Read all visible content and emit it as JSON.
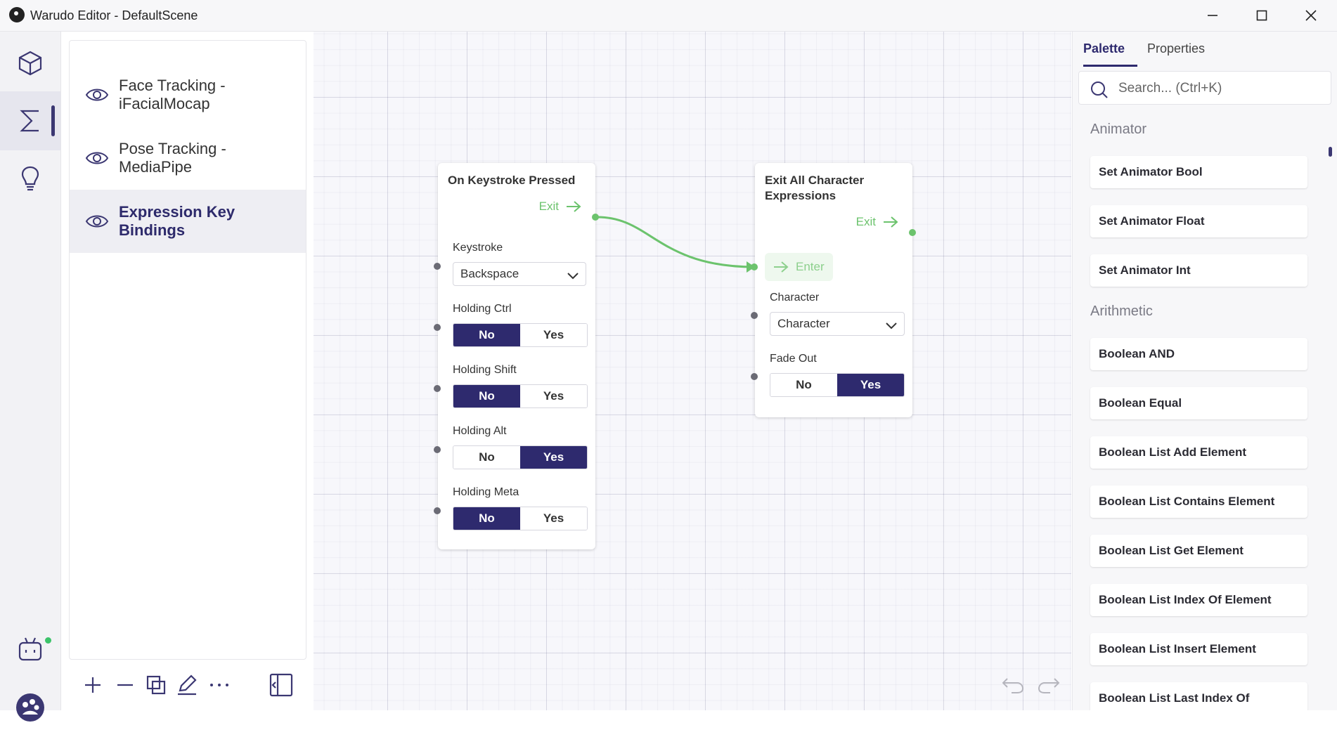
{
  "window": {
    "title": "Warudo Editor - DefaultScene"
  },
  "rail": {
    "items": [
      {
        "icon": "cube-icon"
      },
      {
        "icon": "sigma-icon",
        "active": true
      },
      {
        "icon": "lightbulb-icon"
      }
    ],
    "bottom_items": [
      {
        "icon": "bot-icon",
        "status": "online"
      },
      {
        "icon": "warudo-logo-icon"
      }
    ]
  },
  "graphs": {
    "items": [
      {
        "label": "Face Tracking - iFacialMocap",
        "line1": "Face Tracking -",
        "line2": "iFacialMocap"
      },
      {
        "label": "Pose Tracking - MediaPipe",
        "line1": "Pose Tracking -",
        "line2": "MediaPipe"
      },
      {
        "label": "Expression Key Bindings",
        "line1": "Expression Key",
        "line2": "Bindings",
        "active": true
      }
    ]
  },
  "nodes": {
    "keystroke": {
      "title": "On Keystroke Pressed",
      "exit_label": "Exit",
      "keystroke_label": "Keystroke",
      "keystroke_value": "Backspace",
      "ctrl_label": "Holding Ctrl",
      "shift_label": "Holding Shift",
      "alt_label": "Holding Alt",
      "meta_label": "Holding Meta",
      "no": "No",
      "yes": "Yes",
      "ctrl": false,
      "shift": false,
      "alt": true,
      "meta": false
    },
    "exit_expressions": {
      "title_line1": "Exit All Character",
      "title_line2": "Expressions",
      "exit_label": "Exit",
      "enter_label": "Enter",
      "character_label": "Character",
      "character_value": "Character",
      "fade_label": "Fade Out",
      "no": "No",
      "yes": "Yes",
      "fade_out": true
    }
  },
  "right_panel": {
    "tabs": [
      {
        "label": "Palette",
        "active": true
      },
      {
        "label": "Properties"
      }
    ],
    "search_placeholder": "Search... (Ctrl+K)",
    "sections": [
      {
        "title": "Animator",
        "items": [
          "Set Animator Bool",
          "Set Animator Float",
          "Set Animator Int"
        ]
      },
      {
        "title": "Arithmetic",
        "items": [
          "Boolean AND",
          "Boolean Equal",
          "Boolean List Add Element",
          "Boolean List Contains Element",
          "Boolean List Get Element",
          "Boolean List Index Of Element",
          "Boolean List Insert Element",
          "Boolean List Last Index Of"
        ]
      }
    ]
  },
  "colors": {
    "accent": "#2e2a6e",
    "flow": "#6cc36d",
    "canvas_bg": "#f7f7fb"
  }
}
